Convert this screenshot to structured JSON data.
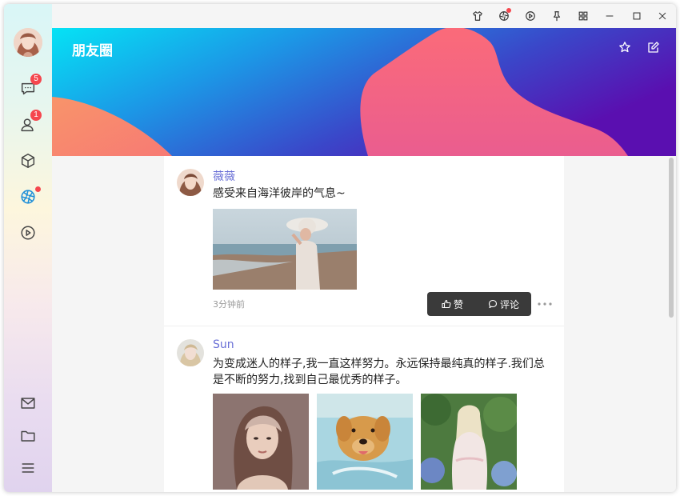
{
  "app": {
    "title": "朋友圈"
  },
  "sidebar": {
    "items": [
      {
        "name": "chat",
        "badge": "5"
      },
      {
        "name": "contacts",
        "badge": "1"
      },
      {
        "name": "cube"
      },
      {
        "name": "moments",
        "dot": true
      },
      {
        "name": "video"
      }
    ],
    "bottom": [
      "mail",
      "folder",
      "menu"
    ]
  },
  "titlebar": {
    "icons": [
      "shirt-icon",
      "moments-icon",
      "play-icon",
      "pin-icon",
      "grid-icon",
      "minimize-icon",
      "maximize-icon",
      "close-icon"
    ]
  },
  "banner": {
    "title": "朋友圈"
  },
  "colors": {
    "accent": "#6a70d6",
    "badge": "#f5474e",
    "action_bar": "#3a3a3a"
  },
  "posts": [
    {
      "user": "薇薇",
      "text": "感受来自海洋彼岸的气息~",
      "time": "3分钟前",
      "like_label": "赞",
      "comment_label": "评论"
    },
    {
      "user": "Sun",
      "text": "为变成迷人的样子,我一直这样努力。永远保持最纯真的样子.我们总是不断的努力,找到自己最优秀的样子。"
    }
  ]
}
